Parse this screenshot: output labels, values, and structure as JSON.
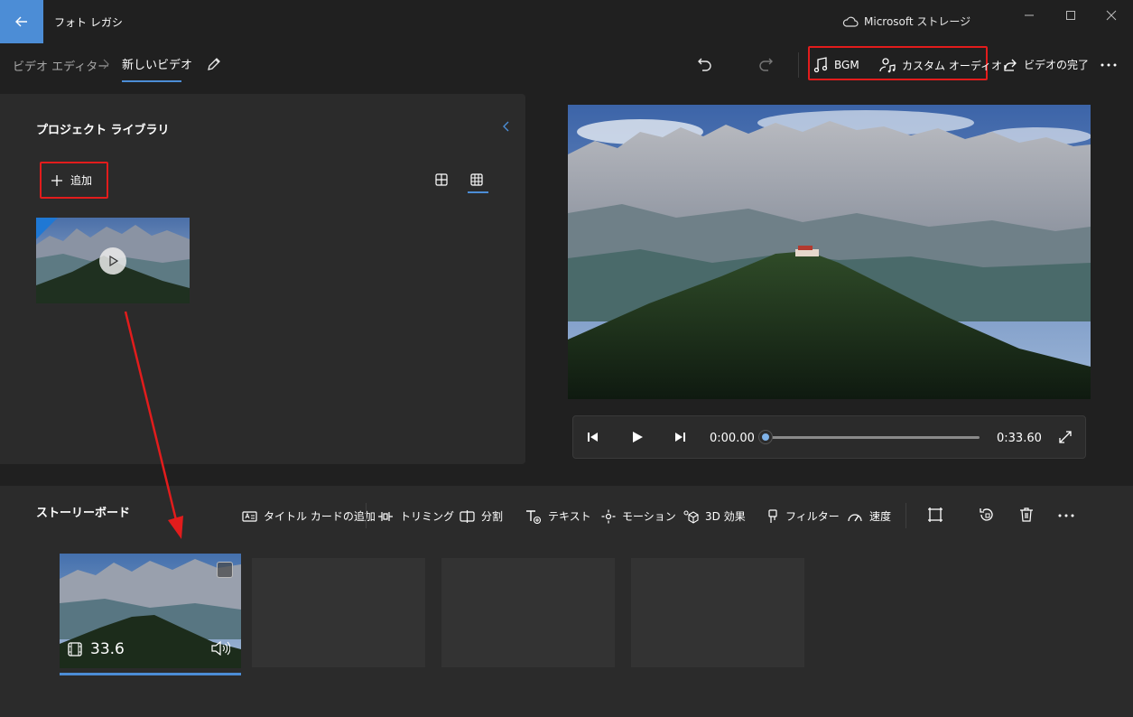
{
  "window": {
    "app_title": "フォト レガシ",
    "storage_label": "Microsoft ストレージ"
  },
  "breadcrumb": {
    "root": "ビデオ エディター",
    "current": "新しいビデオ"
  },
  "toolbar": {
    "bgm_label": "BGM",
    "custom_audio_label": "カスタム オーディオ",
    "finish_label": "ビデオの完了"
  },
  "library": {
    "title": "プロジェクト ライブラリ",
    "add_label": "追加"
  },
  "player": {
    "current_time": "0:00.00",
    "total_time": "0:33.60",
    "progress": 0
  },
  "storyboard": {
    "title": "ストーリーボード",
    "tools": [
      {
        "label": "タイトル カードの追加",
        "icon": "title-card-icon"
      },
      {
        "label": "トリミング",
        "icon": "trim-icon"
      },
      {
        "label": "分割",
        "icon": "split-icon"
      },
      {
        "label": "テキスト",
        "icon": "text-icon"
      },
      {
        "label": "モーション",
        "icon": "motion-icon"
      },
      {
        "label": "3D 効果",
        "icon": "3d-effects-icon"
      },
      {
        "label": "フィルター",
        "icon": "filter-icon"
      },
      {
        "label": "速度",
        "icon": "speed-icon"
      }
    ],
    "clips": [
      {
        "duration": "33.6"
      }
    ]
  },
  "colors": {
    "accent": "#4c8dd6",
    "highlight": "#e21c1c",
    "background": "#202020",
    "panel": "#2b2b2b"
  }
}
